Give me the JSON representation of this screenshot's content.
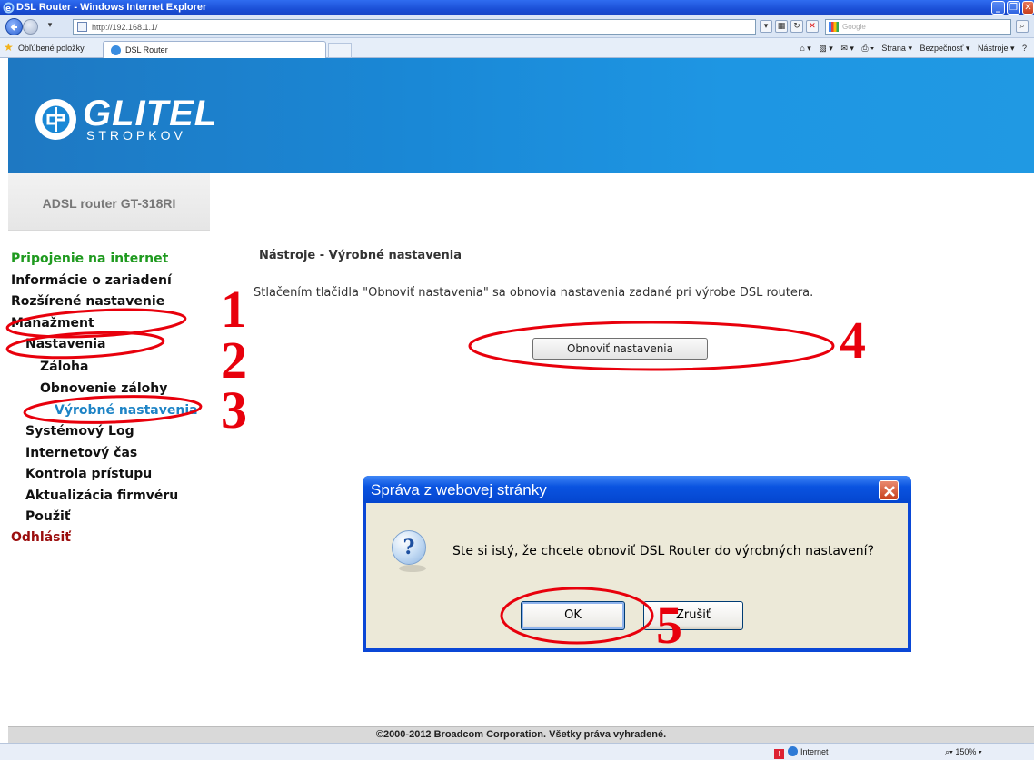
{
  "browser": {
    "window_title": "DSL Router - Windows Internet Explorer",
    "url": "http://192.168.1.1/",
    "search_placeholder": "Google",
    "favorites_label": "Obľúbené položky",
    "tab_title": "DSL Router",
    "command_bar": [
      "Strana ▾",
      "Bezpečnosť ▾",
      "Nástroje ▾"
    ],
    "status_zone": "Internet",
    "zoom": "150%"
  },
  "brand": {
    "logo_text": "GLITEL",
    "logo_sub": "STROPKOV"
  },
  "sidebar": {
    "model": "ADSL router GT-318RI",
    "items": [
      "Pripojenie na internet",
      "Informácie o zariadení",
      "Rozšírené nastavenie",
      "Manažment",
      "Nastavenia",
      "Záloha",
      "Obnovenie zálohy",
      "Výrobné nastavenia",
      "Systémový Log",
      "Internetový čas",
      "Kontrola prístupu",
      "Aktualizácia firmvéru",
      "Použiť",
      "Odhlásiť"
    ]
  },
  "main": {
    "title": "Nástroje - Výrobné nastavenia",
    "description": "Stlačením tlačidla \"Obnoviť nastavenia\" sa obnovia nastavenia zadané pri výrobe DSL routera.",
    "restore_button": "Obnoviť nastavenia"
  },
  "dialog": {
    "title": "Správa z webovej stránky",
    "message": "Ste si istý, že chcete obnoviť DSL Router do výrobných nastavení?",
    "ok": "OK",
    "cancel": "Zrušiť"
  },
  "footer": "©2000-2012 Broadcom Corporation. Všetky práva vyhradené.",
  "annotations": [
    "1",
    "2",
    "3",
    "4",
    "5"
  ],
  "colors": {
    "banner": "#1a88d6",
    "nav_green": "#1f9a1f",
    "nav_active": "#1e84c6",
    "nav_logout": "#9b0e0e",
    "annotation_red": "#e8000c",
    "dialog_title": "#0a53e0"
  }
}
